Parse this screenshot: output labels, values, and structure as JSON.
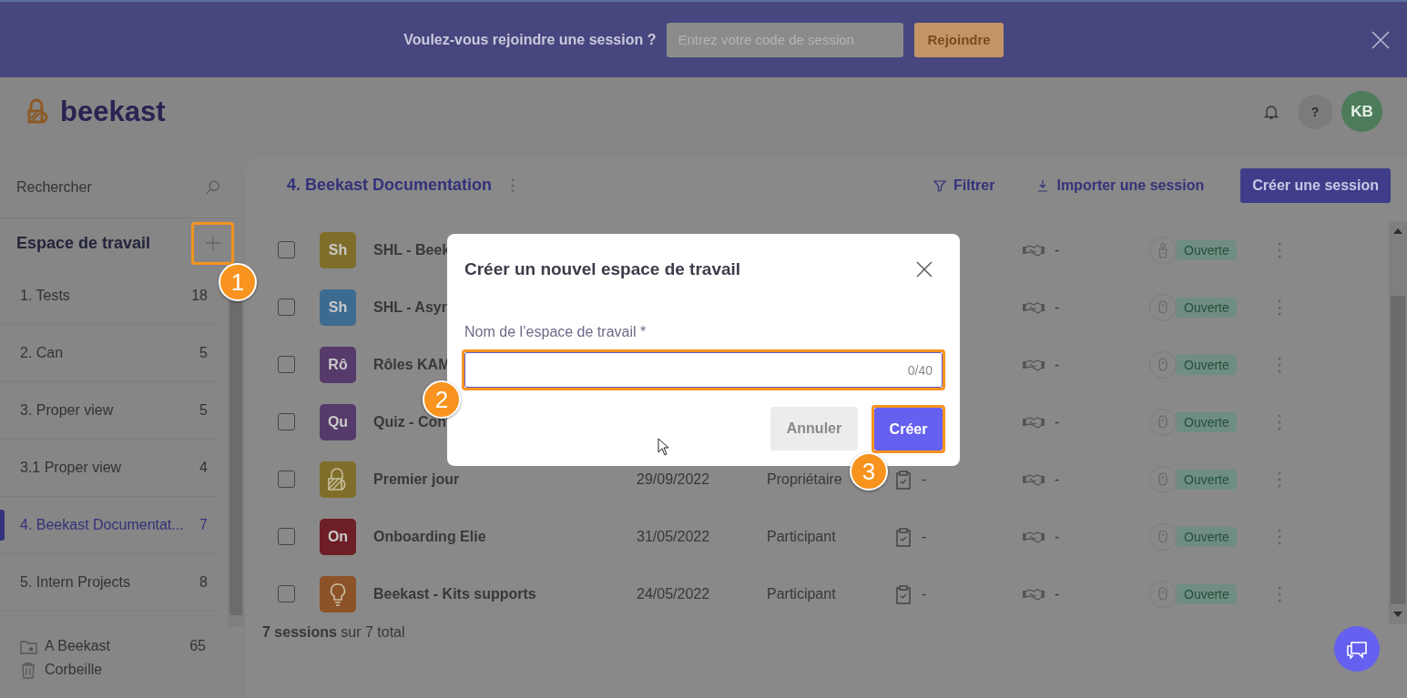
{
  "banner": {
    "prompt": "Voulez-vous rejoindre une session ?",
    "code_field": {
      "placeholder": "Entrez votre code de session"
    },
    "join_button": "Rejoindre"
  },
  "header": {
    "logo": "beekast",
    "help": "?",
    "avatar": "KB"
  },
  "sidebar": {
    "search": {
      "placeholder": "Rechercher"
    },
    "section_title": "Espace de travail",
    "items": [
      {
        "label": "1. Tests",
        "count": "18",
        "selected": false
      },
      {
        "label": "2. Can",
        "count": "5",
        "selected": false
      },
      {
        "label": "3. Proper view",
        "count": "5",
        "selected": false
      },
      {
        "label": "3.1 Proper view",
        "count": "4",
        "selected": false
      },
      {
        "label": "4. Beekast Documentat...",
        "count": "7",
        "selected": true
      },
      {
        "label": "5. Intern Projects",
        "count": "8",
        "selected": false
      }
    ],
    "footer": [
      {
        "kind": "folder",
        "label": "A Beekast",
        "count": "65"
      },
      {
        "kind": "trash",
        "label": "Corbeille"
      }
    ]
  },
  "main": {
    "title": "4. Beekast Documentation",
    "filter": "Filtrer",
    "import": "Importer une session",
    "create": "Créer une session",
    "rows": [
      {
        "checked": false,
        "avatar": {
          "kind": "text",
          "text": "Sh",
          "color": "#7f6e2a"
        },
        "name": "SHL - Beek",
        "participation": "-",
        "mode": {
          "kind": "presenter"
        },
        "status": "Ouverte"
      },
      {
        "checked": false,
        "avatar": {
          "kind": "text",
          "text": "Sh",
          "color": "#3d6a8f"
        },
        "name": "SHL - Asyn",
        "participation": "-",
        "mode": {
          "kind": "mouse"
        },
        "status": "Ouverte"
      },
      {
        "checked": false,
        "avatar": {
          "kind": "text",
          "text": "Rô",
          "color": "#553a6b"
        },
        "name": "Rôles KAM",
        "participation": "-",
        "mode": {
          "kind": "mouse"
        },
        "status": "Ouverte"
      },
      {
        "checked": false,
        "avatar": {
          "kind": "text",
          "text": "Qu",
          "color": "#553a6b"
        },
        "name": "Quiz - Con",
        "participation": "-",
        "mode": {
          "kind": "mouse"
        },
        "status": "Ouverte"
      },
      {
        "checked": false,
        "avatar": {
          "kind": "logo",
          "color": "#7f6e2a"
        },
        "name": "Premier jour",
        "date": "29/09/2022",
        "role": "Propriétaire",
        "type": "-",
        "participation": "-",
        "mode": {
          "kind": "mouse"
        },
        "status": "Ouverte"
      },
      {
        "checked": false,
        "avatar": {
          "kind": "text",
          "text": "On",
          "color": "#6e1e26"
        },
        "name": "Onboarding Elie",
        "date": "31/05/2022",
        "role": "Participant",
        "type": "-",
        "participation": "-",
        "mode": {
          "kind": "mouse"
        },
        "status": "Ouverte"
      },
      {
        "checked": false,
        "avatar": {
          "kind": "bulb",
          "color": "#8c5228"
        },
        "name": "Beekast - Kits supports",
        "date": "24/05/2022",
        "role": "Participant",
        "type": "-",
        "participation": "-",
        "mode": {
          "kind": "mouse"
        },
        "status": "Ouverte"
      }
    ],
    "total": "**7 sessions** sur 7 total"
  },
  "dialog": {
    "title": "Créer un nouvel espace de travail",
    "field_label": "Nom de l’espace de travail *",
    "counter": "0/40",
    "cancel": "Annuler",
    "confirm": "Créer"
  },
  "annotations": [
    {
      "number": "1"
    },
    {
      "number": "2"
    },
    {
      "number": "3"
    }
  ]
}
